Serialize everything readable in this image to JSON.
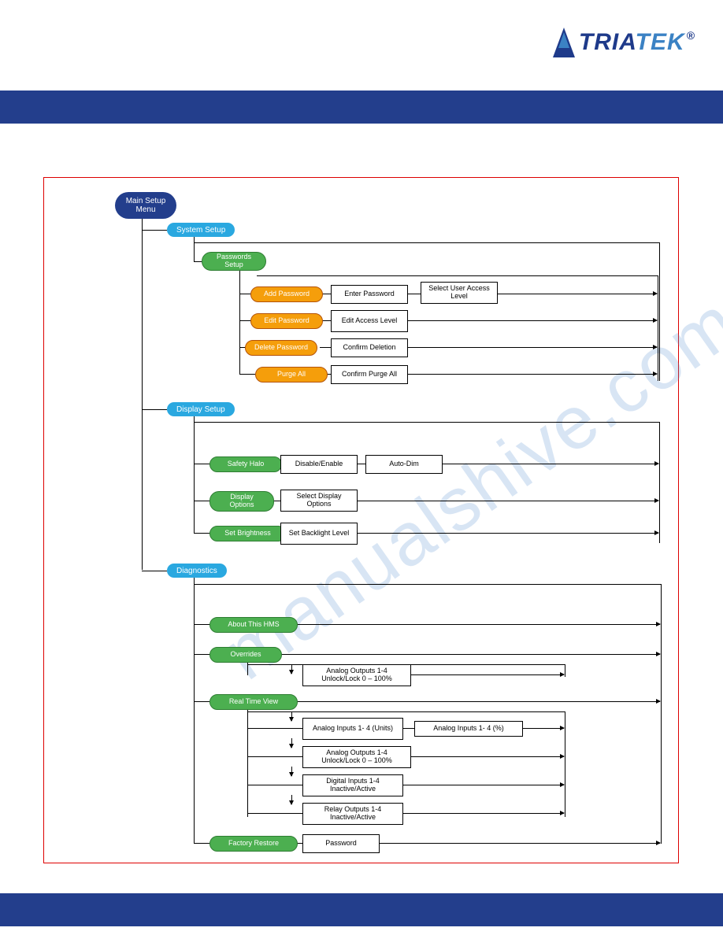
{
  "logo": {
    "part1": "TRIA",
    "part2": "TEK",
    "reg": "®"
  },
  "watermark": "manualshive.com",
  "root": "Main Setup Menu",
  "sections": {
    "system_setup": "System Setup",
    "passwords_setup": "Passwords Setup",
    "add_password": "Add Password",
    "enter_password": "Enter Password",
    "select_user_access": "Select User Access Level",
    "edit_password": "Edit Password",
    "edit_access_level": "Edit Access Level",
    "delete_password": "Delete Password",
    "confirm_deletion": "Confirm Deletion",
    "purge_all": "Purge All",
    "confirm_purge": "Confirm Purge All",
    "display_setup": "Display Setup",
    "safety_halo": "Safety Halo",
    "disable_enable": "Disable/Enable",
    "auto_dim": "Auto-Dim",
    "display_options": "Display Options",
    "select_display_options": "Select Display Options",
    "set_brightness": "Set Brightness",
    "set_backlight": "Set Backlight Level",
    "diagnostics": "Diagnostics",
    "about_hms": "About This HMS",
    "overrides": "Overrides",
    "analog_out_lock1": "Analog Outputs 1-4 Unlock/Lock 0 – 100%",
    "real_time_view": "Real Time View",
    "analog_in_units": "Analog Inputs 1- 4 (Units)",
    "analog_in_pct": "Analog Inputs 1- 4 (%)",
    "analog_out_lock2": "Analog Outputs 1-4 Unlock/Lock 0 – 100%",
    "digital_inputs": "Digital Inputs 1-4 Inactive/Active",
    "relay_outputs": "Relay Outputs 1-4 Inactive/Active",
    "factory_restore": "Factory Restore",
    "password": "Password"
  }
}
